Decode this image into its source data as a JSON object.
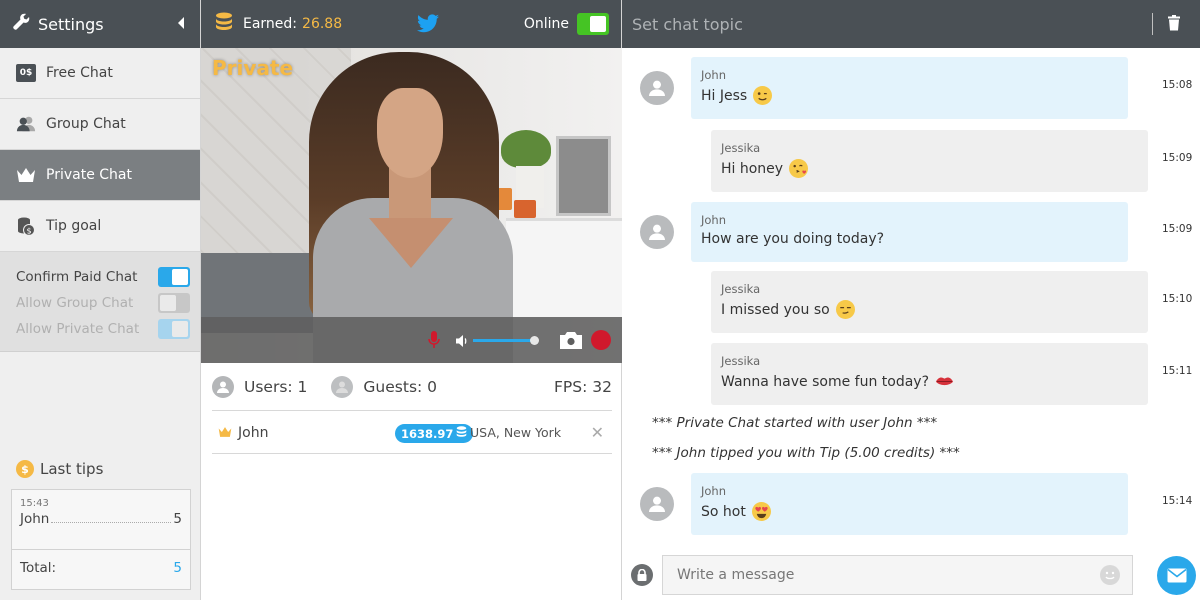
{
  "sidebar": {
    "title": "Settings",
    "items": [
      {
        "label": "Free Chat",
        "icon": "free-chat-icon",
        "badge": "0$",
        "active": false
      },
      {
        "label": "Group Chat",
        "icon": "group-chat-icon",
        "active": false
      },
      {
        "label": "Private Chat",
        "icon": "crown-icon",
        "active": true
      },
      {
        "label": "Tip goal",
        "icon": "coin-stack-icon",
        "active": false
      }
    ],
    "toggles": [
      {
        "label": "Confirm Paid Chat",
        "state": "on",
        "enabled": true
      },
      {
        "label": "Allow Group Chat",
        "state": "off",
        "enabled": false
      },
      {
        "label": "Allow Private Chat",
        "state": "on",
        "enabled": false
      }
    ],
    "last_tips": {
      "title": "Last tips",
      "coin_symbol": "$",
      "entries": [
        {
          "time": "15:43",
          "user": "John",
          "amount": "5"
        }
      ],
      "total_label": "Total:",
      "total_value": "5"
    }
  },
  "video_panel": {
    "earned_label": "Earned:",
    "earned_value": "26.88",
    "online_label": "Online",
    "online": true,
    "mode_label": "Private",
    "volume": 0.95,
    "stats": {
      "users_label": "Users: 1",
      "guests_label": "Guests: 0",
      "fps_label": "FPS: 32"
    },
    "users": [
      {
        "name": "John",
        "credits": "1638.97",
        "location": "USA, New York",
        "kick_symbol": "✕"
      }
    ]
  },
  "chat": {
    "topic_placeholder": "Set chat topic",
    "messages": [
      {
        "type": "user",
        "name": "John",
        "text": "Hi Jess",
        "emoji": "wink",
        "time": "15:08"
      },
      {
        "type": "model",
        "name": "Jessika",
        "text": "Hi honey",
        "emoji": "kiss",
        "time": "15:09"
      },
      {
        "type": "user",
        "name": "John",
        "text": "How are you doing today?",
        "emoji": null,
        "time": "15:09"
      },
      {
        "type": "model",
        "name": "Jessika",
        "text": "I missed you so",
        "emoji": "smirk",
        "time": "15:10"
      },
      {
        "type": "model",
        "name": "Jessika",
        "text": "Wanna have some fun today?",
        "emoji": "lips",
        "time": "15:11"
      },
      {
        "type": "system",
        "text": "*** Private Chat started with user John ***"
      },
      {
        "type": "system",
        "text": "*** John tipped you with Tip (5.00 credits) ***"
      },
      {
        "type": "user",
        "name": "John",
        "text": "So hot",
        "emoji": "heart-eyes",
        "time": "15:14"
      }
    ],
    "input_placeholder": "Write a message"
  },
  "colors": {
    "header_bg": "#4a5055",
    "accent_blue": "#2aa8ea",
    "gold": "#f5b945",
    "online_green": "#45c424",
    "record_red": "#d0192c",
    "user_bubble": "#e3f3fc",
    "model_bubble": "#efefef"
  }
}
